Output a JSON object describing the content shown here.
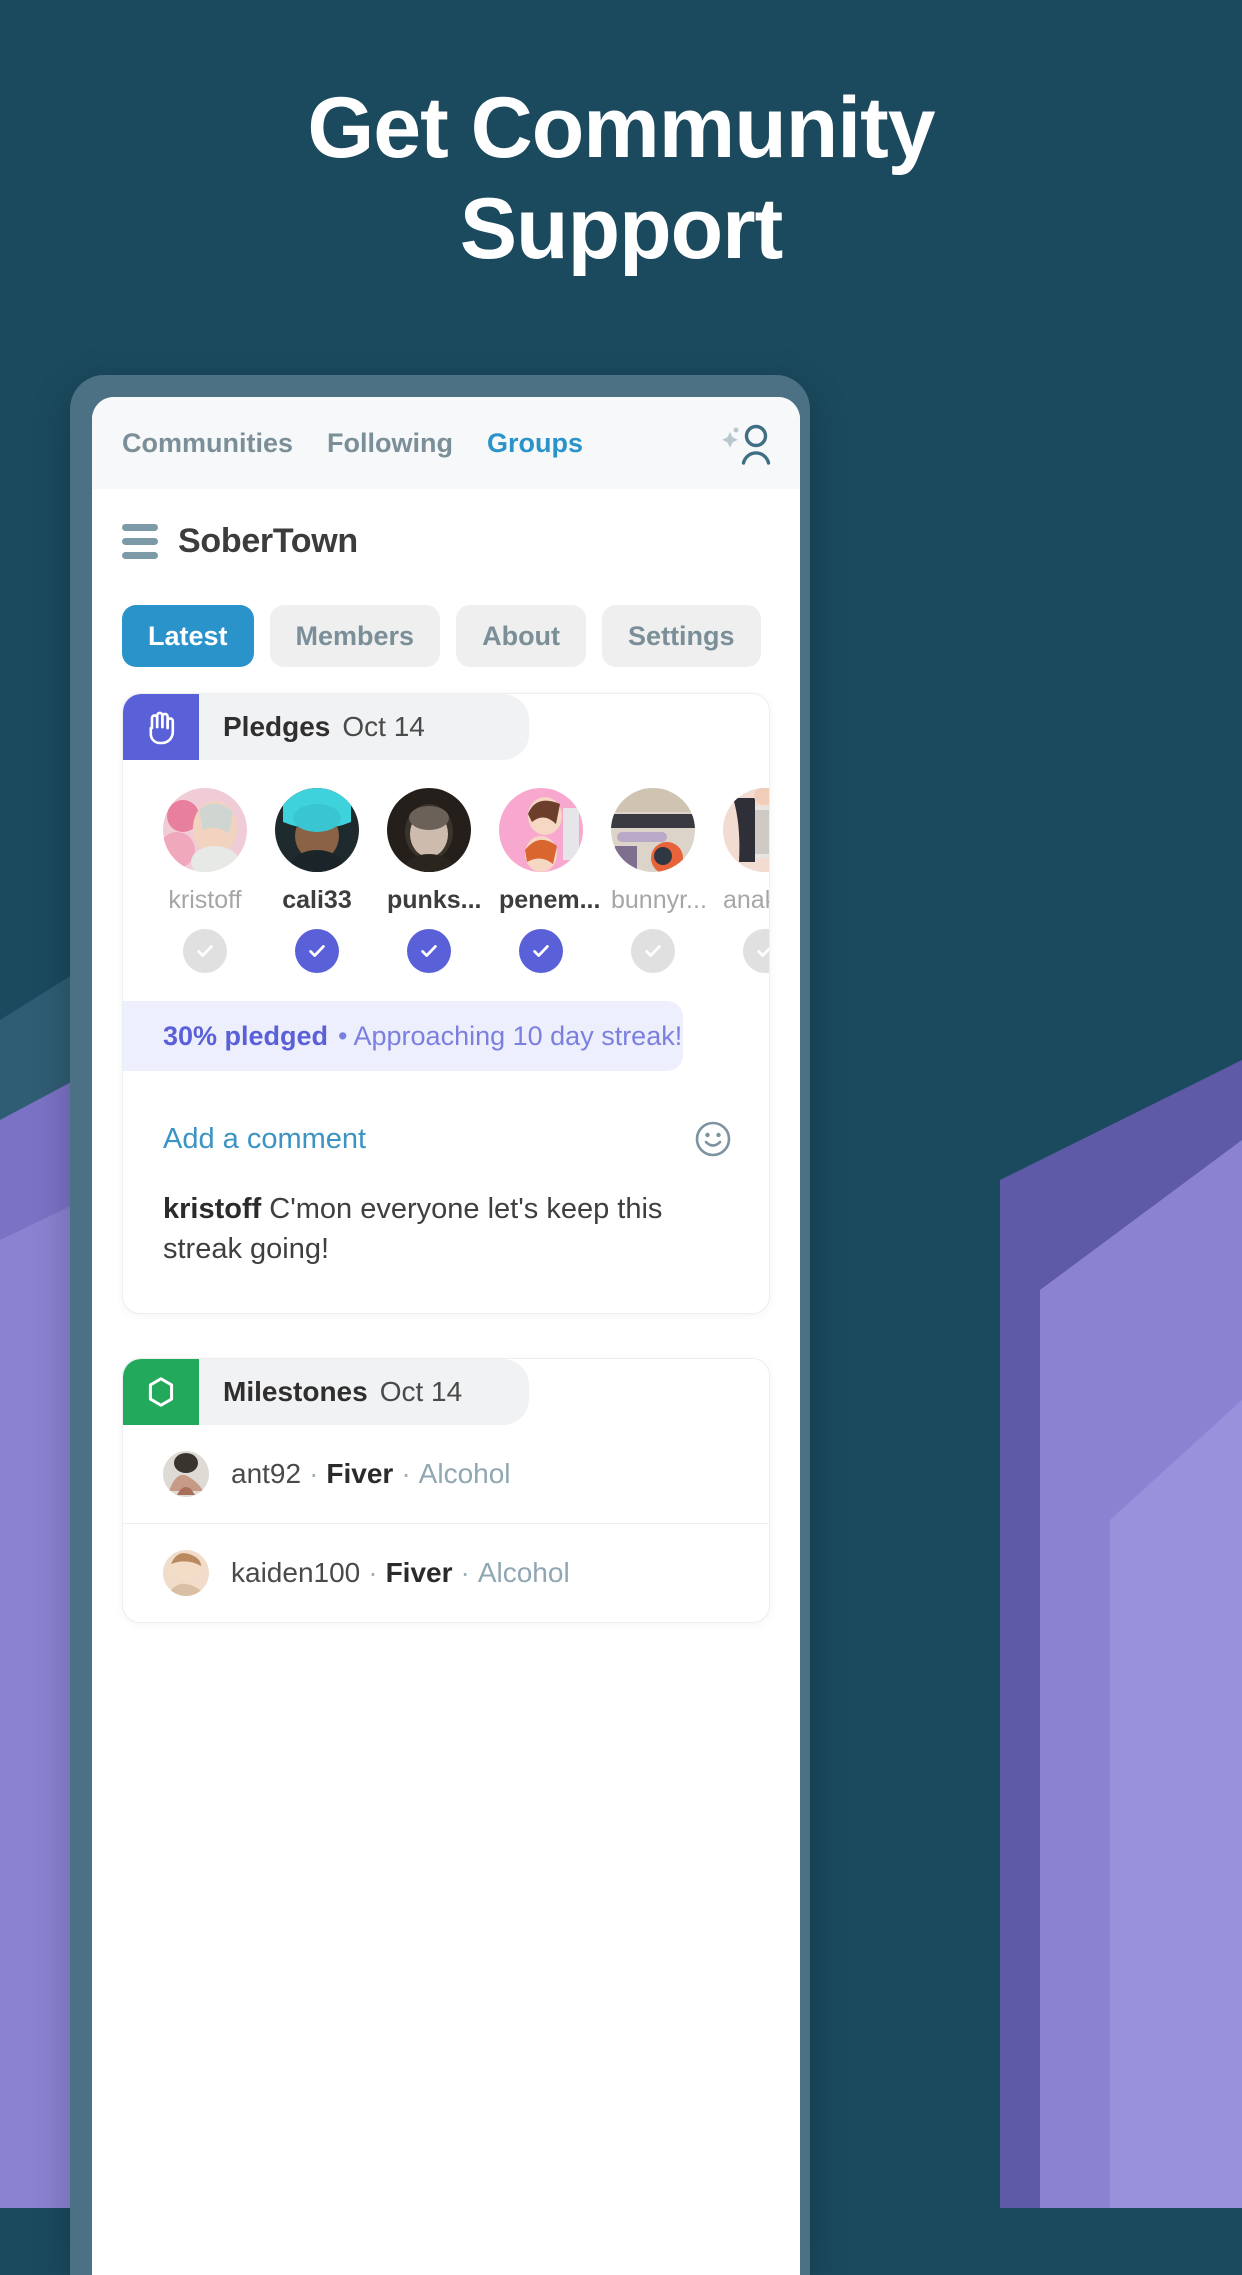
{
  "page": {
    "headline_line1": "Get Community",
    "headline_line2": "Support",
    "bg_color": "#1b4a5e",
    "accent_blue": "#2a93c9",
    "accent_indigo": "#5a60d8",
    "accent_green": "#22a95c"
  },
  "topnav": {
    "tabs": [
      {
        "label": "Communities",
        "active": false
      },
      {
        "label": "Following",
        "active": false
      },
      {
        "label": "Groups",
        "active": true
      }
    ],
    "profile_icon": "person-sparkle-icon"
  },
  "group": {
    "menu_icon": "hamburger-menu-icon",
    "name": "SoberTown",
    "tabs": [
      {
        "label": "Latest",
        "active": true
      },
      {
        "label": "Members",
        "active": false
      },
      {
        "label": "About",
        "active": false
      },
      {
        "label": "Settings",
        "active": false
      }
    ]
  },
  "pledges_card": {
    "badge_icon": "raised-hand-icon",
    "title": "Pledges",
    "date": "Oct 14",
    "pledgers": [
      {
        "name": "kristoff",
        "pledged": false,
        "avatar_colors": [
          "#e8b9c4",
          "#f3d9df",
          "#c9a48f"
        ]
      },
      {
        "name": "cali33",
        "pledged": true,
        "avatar_colors": [
          "#3ecfd6",
          "#1d2b30",
          "#7a5a44"
        ]
      },
      {
        "name": "punks...",
        "pledged": true,
        "avatar_colors": [
          "#2a241f",
          "#c9b49e",
          "#6d5f52"
        ]
      },
      {
        "name": "penem...",
        "pledged": true,
        "avatar_colors": [
          "#f5a3c7",
          "#d96a9c",
          "#8c4a33"
        ]
      },
      {
        "name": "bunnyr...",
        "pledged": false,
        "avatar_colors": [
          "#d8cfc2",
          "#9a8a7a",
          "#4a4a52"
        ]
      },
      {
        "name": "anakki...",
        "pledged": false,
        "avatar_colors": [
          "#efd8cf",
          "#3a3a40",
          "#cfcfcf"
        ]
      }
    ],
    "banner_strong": "30% pledged",
    "banner_rest": "• Approaching 10 day streak!",
    "add_comment_label": "Add a comment",
    "emoji_icon": "smiley-face-icon",
    "comment_user": "kristoff",
    "comment_text": "C'mon everyone let's keep this streak going!"
  },
  "milestones_card": {
    "badge_icon": "hexagon-icon",
    "title": "Milestones",
    "date": "Oct 14",
    "rows": [
      {
        "user": "ant92",
        "badge": "Fiver",
        "category": "Alcohol",
        "avatar_colors": [
          "#c9a090",
          "#5a4a40",
          "#e0dcd6"
        ]
      },
      {
        "user": "kaiden100",
        "badge": "Fiver",
        "category": "Alcohol",
        "avatar_colors": [
          "#f0dcc8",
          "#b08a6a",
          "#d8c0a8"
        ]
      }
    ],
    "separator": "·"
  }
}
